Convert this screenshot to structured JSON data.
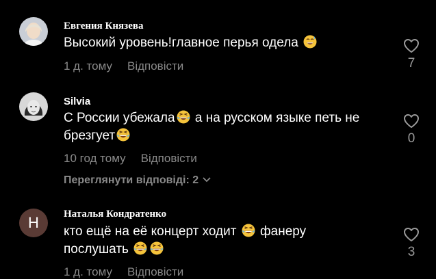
{
  "comments": [
    {
      "author": "Евгения Князева",
      "text_parts": [
        "Высокий уровень!главное перья одела "
      ],
      "time": "1 д. тому",
      "reply_label": "Відповісти",
      "likes": "7"
    },
    {
      "author": "Silvia",
      "text_line1": "С России убежала",
      "text_line1b": " а на русском языке петь не",
      "text_line2": "брезгует",
      "time": "10 год тому",
      "reply_label": "Відповісти",
      "likes": "0",
      "view_replies": "Переглянути відповіді: 2"
    },
    {
      "author": "Наталья Кондратенко",
      "avatar_letter": "Н",
      "text_line1a": "кто ещё на её концерт ходит ",
      "text_line1b": " фанеру",
      "text_line2": "послушать ",
      "time": "1 д. тому",
      "reply_label": "Відповісти",
      "likes": "3"
    }
  ],
  "colors": {
    "background": "#000000",
    "meta_text": "#8a8a8a",
    "letter_avatar": "#5a3b35"
  },
  "icons": [
    "heart-outline-icon",
    "grinning-sweat-emoji",
    "laughing-tears-emoji",
    "chevron-down-icon"
  ]
}
